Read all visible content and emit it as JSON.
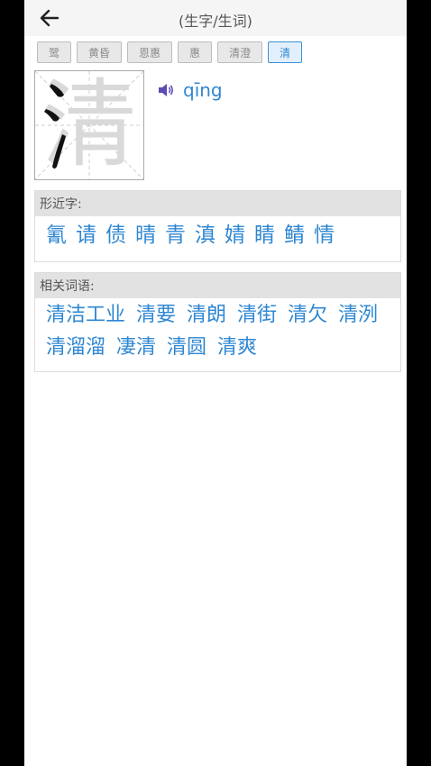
{
  "header": {
    "title": "(生字/生词)"
  },
  "tabs": [
    {
      "label": "鹭",
      "active": false
    },
    {
      "label": "黄昏",
      "active": false
    },
    {
      "label": "恩惠",
      "active": false
    },
    {
      "label": "惠",
      "active": false
    },
    {
      "label": "清澄",
      "active": false
    },
    {
      "label": "清",
      "active": true
    }
  ],
  "character": {
    "char": "清",
    "pinyin": "qīng"
  },
  "similar": {
    "header": "形近字:",
    "items": [
      "氰",
      "请",
      "债",
      "晴",
      "青",
      "滇",
      "婧",
      "睛",
      "鲭",
      "情"
    ]
  },
  "related": {
    "header": "相关词语:",
    "items": [
      "清洁工业",
      "清要",
      "清朗",
      "清街",
      "清欠",
      "清洌",
      "清溜溜",
      "凄清",
      "清圆",
      "清爽"
    ]
  },
  "colors": {
    "accent": "#2f87d2"
  }
}
